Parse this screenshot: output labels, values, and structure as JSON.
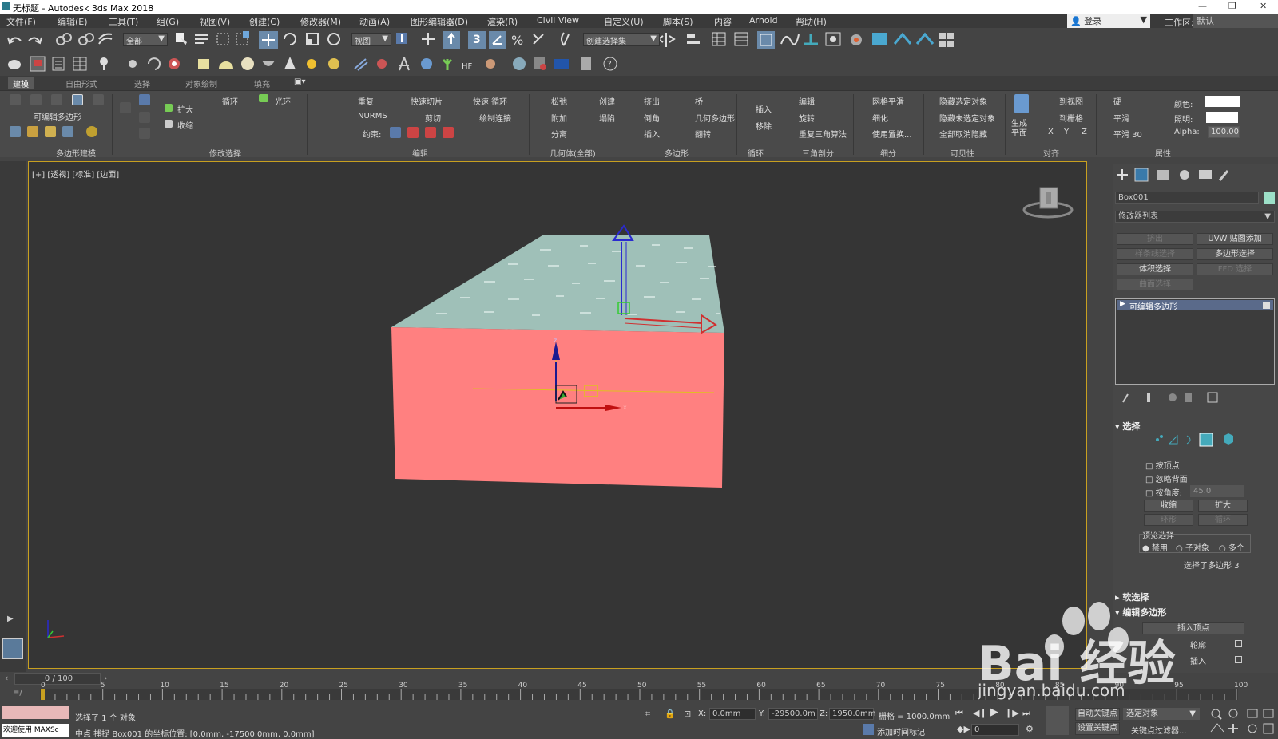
{
  "window": {
    "title": "无标题 - Autodesk 3ds Max 2018"
  },
  "menu": [
    "文件(F)",
    "编辑(E)",
    "工具(T)",
    "组(G)",
    "视图(V)",
    "创建(C)",
    "修改器(M)",
    "动画(A)",
    "图形编辑器(D)",
    "渲染(R)",
    "Civil View",
    "自定义(U)",
    "脚本(S)",
    "内容",
    "Arnold",
    "帮助(H)"
  ],
  "user": {
    "label": "登录"
  },
  "workspace": {
    "label": "工作区:",
    "value": "默认"
  },
  "toolbar": {
    "filter": "全部",
    "refcoord": "视图",
    "named_sel": "创建选择集",
    "snap_label": "3"
  },
  "ribbon_tabs": [
    "建模",
    "自由形式",
    "选择",
    "对象绘制",
    "填充"
  ],
  "ribbon": {
    "editable_poly": "可编辑多边形",
    "polygon_modeling": "多边形建模",
    "grow": "扩大",
    "shrink": "收缩",
    "loop": "循环",
    "ring": "光环",
    "modify_selection": "修改选择",
    "repeat": "重复",
    "nurms": "NURMS",
    "quickslice": "快速切片",
    "cut": "剪切",
    "swiftloop": "快速 循环",
    "paintconnect": "绘制连接",
    "constraints": "约束:",
    "edit": "编辑",
    "relax": "松弛",
    "create": "创建",
    "attach": "附加",
    "collapse": "塌陷",
    "detach": "分离",
    "geometry_all": "几何体(全部)",
    "extrude": "挤出",
    "bridge": "桥",
    "bevel": "倒角",
    "geopoly": "几何多边形",
    "inset": "插入",
    "flip": "翻转",
    "polygons": "多边形",
    "insert": "插入",
    "remove": "移除",
    "loops": "循环",
    "edit2": "编辑",
    "turn": "旋转",
    "retri": "重复三角算法",
    "tris": "三角剖分",
    "meshsmooth": "网格平滑",
    "tessellate": "细化",
    "usedisp": "使用置换...",
    "subdiv": "细分",
    "hide_sel": "隐藏选定对象",
    "hide_unsel": "隐藏未选定对象",
    "unhide_all": "全部取消隐藏",
    "visibility": "可见性",
    "make_planar": "生成平面",
    "to_view": "到视图",
    "to_grid": "到栅格",
    "xyz": [
      "X",
      "Y",
      "Z"
    ],
    "align": "对齐",
    "hard": "硬",
    "smooth": "平滑",
    "smooth30": "平滑 30",
    "color": "颜色:",
    "illum": "照明:",
    "alpha": "Alpha:",
    "alpha_val": "100.00",
    "properties": "属性"
  },
  "viewport": {
    "label": "[+] [透视] [标准] [边面]",
    "face_color": "#ff8080",
    "top_color": "#9fc0b8"
  },
  "cmd": {
    "obj_name": "Box001",
    "modlist": "修改器列表",
    "btns": [
      "挤出",
      "UVW 贴图添加",
      "样条线选择",
      "多边形选择",
      "体积选择",
      "FFD 选择",
      "曲面选择"
    ],
    "stack_item": "可编辑多边形",
    "rollout_sel": "选择",
    "by_vertex": "按顶点",
    "ignore_back": "忽略背面",
    "by_angle": "按角度:",
    "angle_val": "45.0",
    "shrink": "收缩",
    "grow": "扩大",
    "ring": "环形",
    "loop": "循环",
    "preview": "预览选择",
    "disabled": "禁用",
    "subobj": "子对象",
    "multi": "多个",
    "sel_info": "选择了多边形 3",
    "soft": "软选择",
    "edit_poly": "编辑多边形",
    "insert_vertex": "插入顶点",
    "outline": "轮廓",
    "inset": "插入"
  },
  "timeline": {
    "frame": "0 / 100",
    "ticks": [
      "0",
      "5",
      "10",
      "15",
      "20",
      "25",
      "30",
      "35",
      "40",
      "45",
      "50",
      "55",
      "60",
      "65",
      "70",
      "75",
      "80",
      "85",
      "90",
      "95",
      "100"
    ]
  },
  "status": {
    "welcome": "欢迎使用 MAXSc",
    "selected": "选择了 1 个 对象",
    "prompt": "中点 捕捉 Box001 的坐标位置: [0.0mm, -17500.0mm, 0.0mm]",
    "x_label": "X:",
    "x": "0.0mm",
    "y_label": "Y:",
    "y": "-29500.0m",
    "z_label": "Z:",
    "z": "1950.0mm",
    "grid": "栅格 = 1000.0mm",
    "autokey": "自动关键点",
    "selobj": "选定对象",
    "setkey": "设置关键点",
    "keyfilter": "关键点过滤器...",
    "addtime": "添加时间标记",
    "frame": "0"
  },
  "watermark": {
    "text": "Bai 经验",
    "url": "jingyan.baidu.com"
  }
}
